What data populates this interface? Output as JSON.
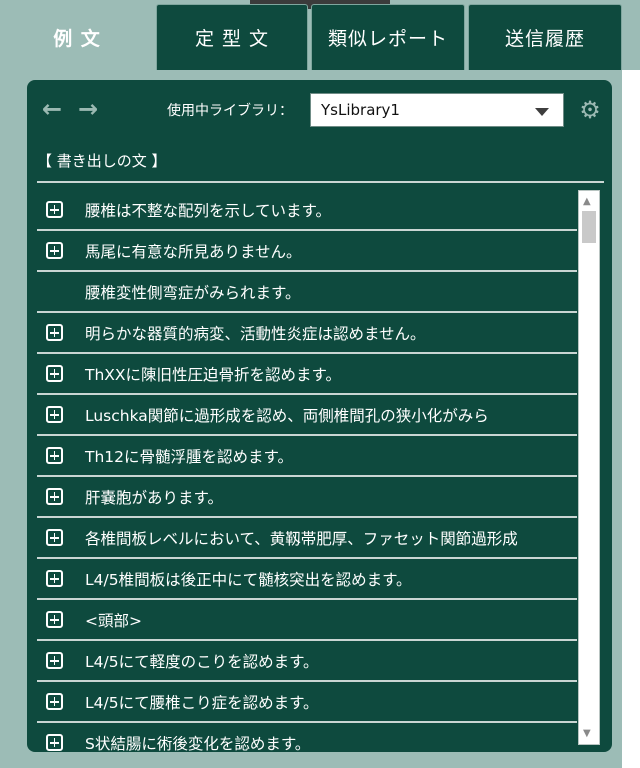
{
  "tabs": [
    {
      "label": "例 文",
      "active": true
    },
    {
      "label": "定 型 文",
      "active": false
    },
    {
      "label": "類似レポート",
      "active": false
    },
    {
      "label": "送信履歴",
      "active": false
    }
  ],
  "toolbar": {
    "library_label": "使用中ライブラリ：",
    "library_value": "YsLibrary1"
  },
  "section_title": "【 書き出しの文 】",
  "rows": [
    {
      "text": "腰椎は不整な配列を示しています。",
      "expandable": true
    },
    {
      "text": "馬尾に有意な所見ありません。",
      "expandable": true
    },
    {
      "text": "腰椎変性側弯症がみられます。",
      "expandable": false
    },
    {
      "text": "明らかな器質的病変、活動性炎症は認めません。",
      "expandable": true
    },
    {
      "text": "ThXXに陳旧性圧迫骨折を認めます。",
      "expandable": true
    },
    {
      "text": "Luschka関節に過形成を認め、両側椎間孔の狭小化がみら",
      "expandable": true
    },
    {
      "text": "Th12に骨髄浮腫を認めます。",
      "expandable": true
    },
    {
      "text": "肝嚢胞があります。",
      "expandable": true
    },
    {
      "text": "各椎間板レベルにおいて、黄靱帯肥厚、ファセット関節過形成",
      "expandable": true
    },
    {
      "text": "L4/5椎間板は後正中にて髄核突出を認めます。",
      "expandable": true
    },
    {
      "text": "<頭部>",
      "expandable": true
    },
    {
      "text": "L4/5にて軽度のこりを認めます。",
      "expandable": true
    },
    {
      "text": "L4/5にて腰椎こり症を認めます。",
      "expandable": true
    },
    {
      "text": "S状結腸に術後変化を認めます。",
      "expandable": true
    }
  ],
  "colors": {
    "panel": "#0e4a3e",
    "background": "#9cbcb6",
    "icon": "#9bb9b2"
  },
  "icons": {
    "back": "arrow-left-icon",
    "forward": "arrow-right-icon",
    "settings": "gear-icon",
    "expand": "plus-box-icon",
    "dropdown": "chevron-down-icon"
  }
}
